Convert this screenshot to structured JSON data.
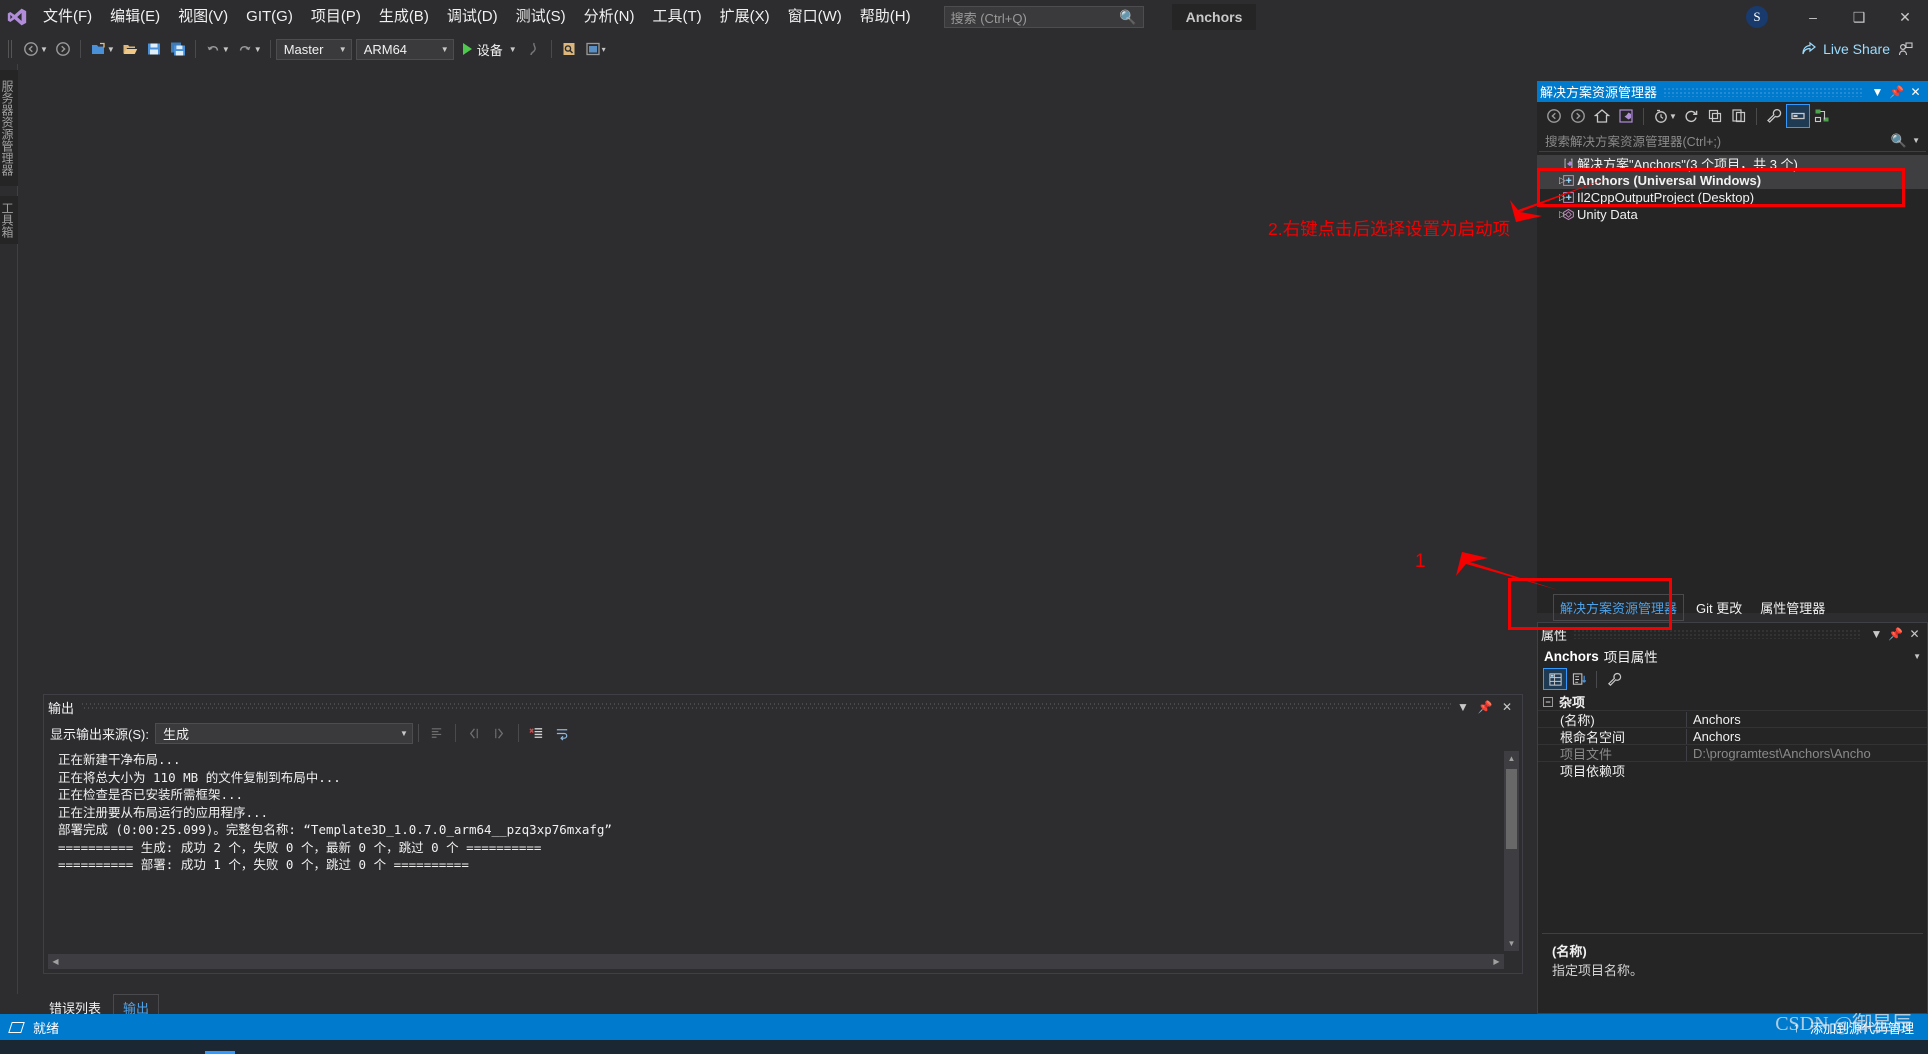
{
  "app": {
    "window_title": "Anchors",
    "avatar_initial": "S",
    "live_share": "Live Share"
  },
  "menubar": {
    "items": [
      {
        "label": "文件(F)"
      },
      {
        "label": "编辑(E)"
      },
      {
        "label": "视图(V)"
      },
      {
        "label": "GIT(G)"
      },
      {
        "label": "项目(P)"
      },
      {
        "label": "生成(B)"
      },
      {
        "label": "调试(D)"
      },
      {
        "label": "测试(S)"
      },
      {
        "label": "分析(N)"
      },
      {
        "label": "工具(T)"
      },
      {
        "label": "扩展(X)"
      },
      {
        "label": "窗口(W)"
      },
      {
        "label": "帮助(H)"
      }
    ],
    "search_placeholder": "搜索 (Ctrl+Q)"
  },
  "toolbar": {
    "branch": "Master",
    "platform": "ARM64",
    "run_target": "设备"
  },
  "left_rail": {
    "server_explorer": "服务器资源管理器",
    "toolbox": "工具箱"
  },
  "output_panel": {
    "title": "输出",
    "source_label": "显示输出来源(S):",
    "source_value": "生成",
    "lines": [
      "正在新建干净布局...",
      "正在将总大小为 110 MB 的文件复制到布局中...",
      "正在检查是否已安装所需框架...",
      "正在注册要从布局运行的应用程序...",
      "部署完成 (0:00:25.099)。完整包名称: “Template3D_1.0.7.0_arm64__pzq3xp76mxafg”",
      "========== 生成: 成功 2 个，失败 0 个，最新 0 个，跳过 0 个 ==========",
      "========== 部署: 成功 1 个，失败 0 个，跳过 0 个 =========="
    ]
  },
  "bottom_tabs": {
    "items": [
      {
        "label": "错误列表",
        "active": false
      },
      {
        "label": "输出",
        "active": true
      }
    ]
  },
  "status_bar": {
    "left_text": "就绪",
    "right_text": "添加到源代码管理",
    "watermark": "CSDN @御星辰"
  },
  "solution_explorer": {
    "title": "解决方案资源管理器",
    "search_placeholder": "搜索解决方案资源管理器(Ctrl+;)",
    "tree": [
      {
        "label": "解决方案\"Anchors\"(3 个项目，共 3 个)",
        "icon": "solution-icon",
        "indent": 0,
        "expander": "",
        "state": "solution"
      },
      {
        "label": "Anchors (Universal Windows)",
        "icon": "project-icon",
        "indent": 1,
        "expander": "▷",
        "state": "selected"
      },
      {
        "label": "Il2CppOutputProject (Desktop)",
        "icon": "project-icon",
        "indent": 1,
        "expander": "▷",
        "state": "normal"
      },
      {
        "label": "Unity Data",
        "icon": "unity-icon",
        "indent": 1,
        "expander": "▷",
        "state": "normal"
      }
    ],
    "dock_tabs": [
      {
        "label": "解决方案资源管理器",
        "active": true
      },
      {
        "label": "Git 更改",
        "active": false
      },
      {
        "label": "属性管理器",
        "active": false
      }
    ]
  },
  "properties": {
    "title": "属性",
    "subject_name": "Anchors",
    "subject_kind": "项目属性",
    "category": "杂项",
    "rows": [
      {
        "key": "(名称)",
        "value": "Anchors",
        "dim": false
      },
      {
        "key": "根命名空间",
        "value": "Anchors",
        "dim": false
      },
      {
        "key": "项目文件",
        "value": "D:\\programtest\\Anchors\\Ancho",
        "dim": true
      },
      {
        "key": "项目依赖项",
        "value": "",
        "dim": false
      }
    ],
    "description_title": "(名称)",
    "description_body": "指定项目名称。"
  },
  "annotations": {
    "step1": "1",
    "step2": "2.右键点击后选择设置为启动项",
    "accent_color": "#f40000"
  }
}
